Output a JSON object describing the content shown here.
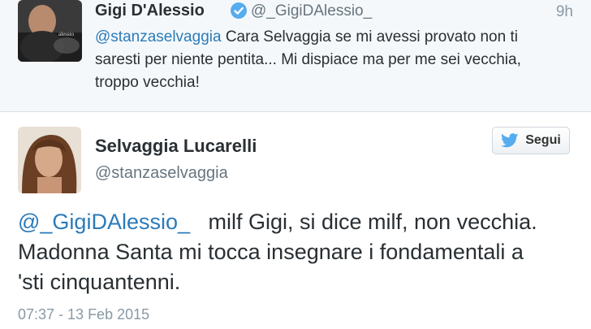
{
  "tweet_top": {
    "name": "Gigi D'Alessio",
    "handle": "@_GigiDAlessio_",
    "time": "9h",
    "mention": "@stanzaselvaggia",
    "text": " Cara Selvaggia se mi avessi provato non ti saresti per niente pentita... Mi dispiace ma per me sei vecchia, troppo vecchia!"
  },
  "tweet_main": {
    "name": "Selvaggia Lucarelli",
    "handle": "@stanzaselvaggia",
    "follow_label": "Segui",
    "mention": "@_GigiDAlessio_",
    "text": "   milf Gigi, si dice milf, non vecchia. Madonna Santa mi tocca insegnare i fondamentali a 'sti cinquantenni.",
    "timestamp": "07:37 - 13 Feb 2015"
  },
  "colors": {
    "link": "#2b7bb9",
    "verified": "#55acee",
    "twitter_bird": "#55acee"
  },
  "icons": {
    "verified": "verified-badge-icon",
    "follow": "twitter-bird-icon"
  }
}
